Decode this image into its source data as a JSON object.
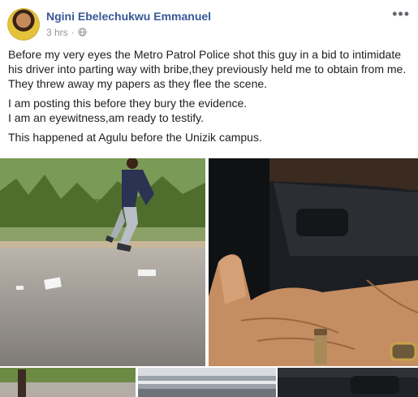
{
  "post": {
    "author": "Ngini Ebelechukwu Emmanuel",
    "time": "3 hrs",
    "paragraphs": [
      "Before my very eyes the Metro Patrol Police shot this guy in a bid to intimidate his driver into parting way with bribe,they previously held me to obtain from me. They threw away my papers as they flee the scene.",
      "I am posting this before they bury the evidence.\nI am an eyewitness,am ready to testify.",
      "This happened at Agulu before the Unizik campus."
    ]
  },
  "icons": {
    "privacy": "globe-icon",
    "menu": "more-options-icon"
  },
  "colors": {
    "author_link": "#385898",
    "meta_text": "#90949c",
    "body_text": "#1c1e21"
  },
  "photos": [
    {
      "name": "photo-roadside-man"
    },
    {
      "name": "photo-hand-bullet-casing"
    },
    {
      "name": "photo-thumbnail-road"
    },
    {
      "name": "photo-thumbnail-window"
    },
    {
      "name": "photo-thumbnail-car-interior"
    }
  ]
}
